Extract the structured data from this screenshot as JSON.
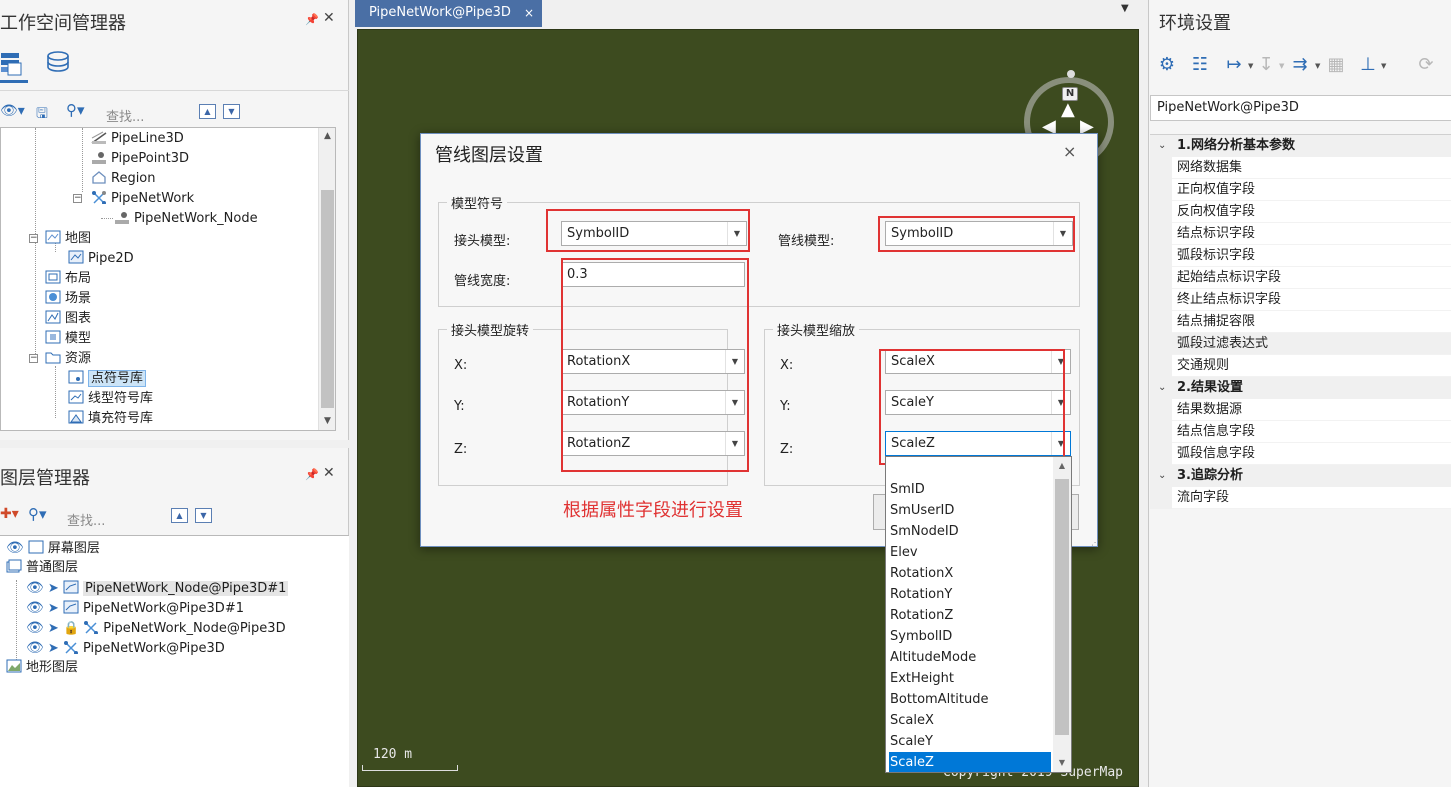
{
  "workspace_panel": {
    "title": "工作空间管理器",
    "search_placeholder": "查找...",
    "tree": [
      {
        "label": "PipeLine3D"
      },
      {
        "label": "PipePoint3D"
      },
      {
        "label": "Region"
      },
      {
        "label": "PipeNetWork"
      },
      {
        "label": "PipeNetWork_Node"
      },
      {
        "label": "地图"
      },
      {
        "label": "Pipe2D"
      },
      {
        "label": "布局"
      },
      {
        "label": "场景"
      },
      {
        "label": "图表"
      },
      {
        "label": "模型"
      },
      {
        "label": "资源"
      },
      {
        "label": "点符号库"
      },
      {
        "label": "线型符号库"
      },
      {
        "label": "填充符号库"
      }
    ]
  },
  "layer_panel": {
    "title": "图层管理器",
    "search_placeholder": "查找...",
    "tree": [
      {
        "label": "屏幕图层"
      },
      {
        "label": "普通图层"
      },
      {
        "label": "PipeNetWork_Node@Pipe3D#1"
      },
      {
        "label": "PipeNetWork@Pipe3D#1"
      },
      {
        "label": "PipeNetWork_Node@Pipe3D"
      },
      {
        "label": "PipeNetWork@Pipe3D"
      },
      {
        "label": "地形图层"
      }
    ]
  },
  "scene": {
    "tab_label": "PipeNetWork@Pipe3D",
    "tab_close": "×",
    "compass_label": "N",
    "scale_text": "120 m",
    "copyright": "Copyright 2019 SuperMap"
  },
  "dialog": {
    "title": "管线图层设置",
    "close": "×",
    "group_symbol": "模型符号",
    "joint_model_label": "接头模型:",
    "joint_model_value": "SymbolID",
    "pipe_model_label": "管线模型:",
    "pipe_model_value": "SymbolID",
    "pipe_width_label": "管线宽度:",
    "pipe_width_value": "0.3",
    "group_rotation": "接头模型旋转",
    "group_scale": "接头模型缩放",
    "x_label": "X:",
    "y_label": "Y:",
    "z_label": "Z:",
    "rot_x": "RotationX",
    "rot_y": "RotationY",
    "rot_z": "RotationZ",
    "scale_x": "ScaleX",
    "scale_y": "ScaleY",
    "scale_z": "ScaleZ",
    "note": "根据属性字段进行设置"
  },
  "dropdown_options": [
    "",
    "SmID",
    "SmUserID",
    "SmNodeID",
    "Elev",
    "RotationX",
    "RotationY",
    "RotationZ",
    "SymbolID",
    "AltitudeMode",
    "ExtHeight",
    "BottomAltitude",
    "ScaleX",
    "ScaleY",
    "ScaleZ"
  ],
  "dropdown_selected": "ScaleZ",
  "env_panel": {
    "title": "环境设置",
    "combo_value": "PipeNetWork@Pipe3D",
    "categories": [
      {
        "title": "1.网络分析基本参数",
        "items": [
          "网络数据集",
          "正向权值字段",
          "反向权值字段",
          "结点标识字段",
          "弧段标识字段",
          "起始结点标识字段",
          "终止结点标识字段",
          "结点捕捉容限",
          "弧段过滤表达式",
          "交通规则"
        ]
      },
      {
        "title": "2.结果设置",
        "items": [
          "结果数据源",
          "结点信息字段",
          "弧段信息字段"
        ]
      },
      {
        "title": "3.追踪分析",
        "items": [
          "流向字段"
        ]
      }
    ]
  },
  "colors": {
    "accent": "#4a6fa5",
    "highlight": "#e03333",
    "selection": "#0078d7",
    "scene_bg": "#3d4b1f"
  }
}
